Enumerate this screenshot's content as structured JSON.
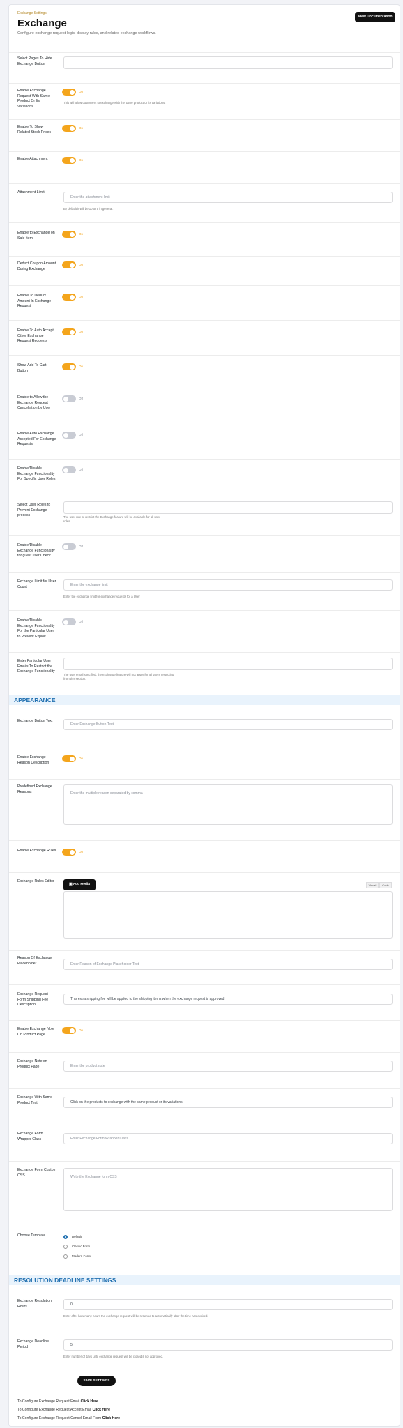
{
  "header": {
    "crumb": "Exchange Settings",
    "title": "Exchange",
    "subtitle": "Configure exchange request logic, display rules, and related exchange workflows.",
    "doc_button": "View Documentation"
  },
  "general": {
    "select_pages_label": "Select Pages To Hide Exchange Button",
    "same_product_label": "Enable Exchange Request With Same Product Or Its Variations",
    "same_product_toggle": "On",
    "same_product_help": "This will allow customers to exchange with the same product or its variations.",
    "show_related_label": "Enable To Show Related Stock Prices",
    "show_related_toggle": "On",
    "attachment_label": "Enable Attachment",
    "attachment_toggle": "On",
    "attachment_limit_label": "Attachment Limit",
    "attachment_limit_placeholder": "Enter the attachment limit",
    "attachment_limit_help": "By default it will be 10 or 5 in general.",
    "exchange_on_sale_label": "Enable to Exchange on Sale Item",
    "exchange_on_sale_toggle": "On",
    "deduct_coupon_label": "Deduct Coupon Amount During Exchange",
    "deduct_coupon_toggle": "On",
    "deduct_wallet_label": "Enable To Deduct Amount In Exchange Request",
    "deduct_wallet_toggle": "On",
    "auto_accept_label": "Enable To Auto Accept Other Exchange Request Requests",
    "auto_accept_toggle": "On",
    "show_tax_label": "Show Add To Cart Button",
    "show_tax_toggle": "On",
    "cancel_label": "Enable to Allow the Exchange Request Cancellation by User",
    "cancel_toggle": "Off",
    "auto_exchange_label": "Enable Auto Exchange Accepted For Exchange Requests",
    "auto_exchange_toggle": "Off",
    "specific_roles_label": "Enable/Disable Exchange Functionality For Specific User Roles",
    "specific_roles_toggle": "Off",
    "select_roles_label": "Select User Roles to Prevent Exchange process",
    "select_roles_help": "The user role to restrict the Exchange feature will be available for all user roles.",
    "guest_user_label": "Enable/Disable Exchange Functionality for guest user Check",
    "guest_user_toggle": "Off",
    "limit_label": "Exchange Limit for User Count",
    "limit_placeholder": "Enter the exchange limit",
    "limit_help": "Enter the exchange limit for exchange requests for a User",
    "quantity_label": "Enable/Disable Exchange Functionality For the Particular User to Prevent Exploit",
    "quantity_toggle": "Off",
    "email_block_label": "Enter Particular User Emails To Restrict the Exchange Functionality",
    "email_block_help": "The user email specified, the exchange feature will not apply for all users restricting from this section."
  },
  "appearance": {
    "section_title": "APPEARANCE",
    "button_text_label": "Exchange Button Text",
    "button_text_placeholder": "Enter Exchange Button Text",
    "predefined_label": "Enable Exchange Reason Description",
    "predefined_toggle": "On",
    "reasons_label": "Predefined Exchange Reasons",
    "reasons_placeholder": "Enter the multiple reason separated by comma",
    "rules_toggle_label": "Enable Exchange Rules",
    "rules_toggle": "On",
    "rules_editor_label": "Exchange Rules Editor",
    "add_media": "Add Media",
    "visual_tab": "Visual",
    "code_tab": "Code",
    "reason_placeholder_label": "Reason Of Exchange Placeholder",
    "reason_placeholder_value": "Enter Reason of Exchange Placeholder Text",
    "shipping_label": "Exchange Request Form Shipping Fee Description",
    "shipping_value": "This extra shipping fee will be applied to the shipping items when the exchange request is approved",
    "product_page_label": "Enable Exchange Note On Product Page",
    "product_page_toggle": "On",
    "note_label": "Exchange Note on Product Page",
    "note_placeholder": "Enter the product note",
    "same_product_text_label": "Exchange With Same Product Text",
    "same_product_text_value": "Click on the products to exchange with the same product or its variations",
    "form_wrapper_label": "Exchange Form Wrapper Class",
    "form_wrapper_placeholder": "Enter Exchange Form Wrapper Class",
    "custom_css_label": "Exchange Form Custom CSS",
    "custom_css_placeholder": "Write the Exchange form CSS",
    "template_label": "Choose Template",
    "template_options": [
      "Default",
      "Classic Form",
      "Modern Form"
    ]
  },
  "deadline": {
    "section_title": "RESOLUTION DEADLINE SETTINGS",
    "hours_label": "Exchange Resolution Hours",
    "hours_value": "0",
    "hours_help": "Enter after how many hours the exchange request will be returned to automatically after the time has expired.",
    "days_label": "Exchange Deadline Period",
    "days_value": "5",
    "days_help": "Enter number of days until exchange request will be closed if not approved."
  },
  "footer": {
    "save": "SAVE SETTINGS",
    "links": [
      {
        "text": "To Configure Exchange Request Email",
        "link": "Click Here"
      },
      {
        "text": "To Configure Exchange Request Accept Email",
        "link": "Click Here"
      },
      {
        "text": "To Configure Exchange Request Cancel Email Form",
        "link": "Click Here"
      }
    ]
  }
}
